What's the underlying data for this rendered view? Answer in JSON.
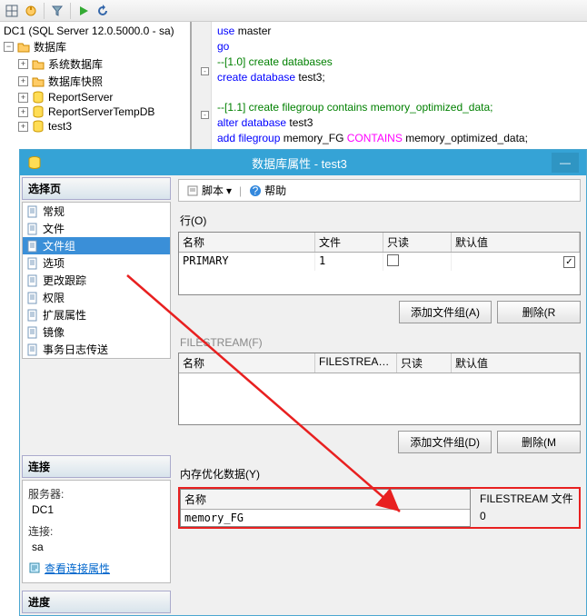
{
  "toolbar": {
    "icons": [
      "grid",
      "conn",
      "sep",
      "filter",
      "sep",
      "play",
      "refresh"
    ]
  },
  "server": {
    "name": "DC1 (SQL Server 12.0.5000.0 - sa)"
  },
  "tree": {
    "root": "数据库",
    "items": [
      "系统数据库",
      "数据库快照",
      "ReportServer",
      "ReportServerTempDB",
      "test3"
    ]
  },
  "editor": {
    "lines": [
      {
        "t": "use",
        "k": "kw",
        "r": " master"
      },
      {
        "t": "go",
        "k": "kw"
      },
      {
        "t": "--[1.0] create databases",
        "k": "comment"
      },
      {
        "pre": "create database",
        "post": " test3;",
        "collapse": true
      },
      {
        "t": "",
        "k": "ident"
      },
      {
        "t": "--[1.1] create filegroup contains memory_optimized_data;",
        "k": "comment"
      },
      {
        "pre": "alter database",
        "post": " test3",
        "collapse": true
      },
      {
        "add": "add filegroup",
        "name": " memory_FG ",
        "kw2": "CONTAINS",
        "end": " memory_optimized_data;"
      }
    ]
  },
  "dialog": {
    "title": "数据库属性 - test3",
    "left": {
      "sel_header": "选择页",
      "pages": [
        "常规",
        "文件",
        "文件组",
        "选项",
        "更改跟踪",
        "权限",
        "扩展属性",
        "镜像",
        "事务日志传送"
      ],
      "selected": "文件组",
      "conn_header": "连接",
      "server_lbl": "服务器:",
      "server_val": "DC1",
      "conn_lbl": "连接:",
      "conn_val": "sa",
      "view_link": "查看连接属性",
      "progress_header": "进度"
    },
    "right": {
      "script_btn": "脚本",
      "help_btn": "帮助",
      "rows_label": "行(O)",
      "grid1": {
        "cols": [
          "名称",
          "文件",
          "只读",
          "默认值"
        ],
        "row": {
          "name": "PRIMARY",
          "files": "1",
          "readonly": "",
          "default": "✓"
        }
      },
      "add_btn": "添加文件组(A)",
      "del_btn": "删除(R",
      "fs_label": "FILESTREAM(F)",
      "grid2": {
        "cols": [
          "名称",
          "FILESTREA…",
          "只读",
          "默认值"
        ]
      },
      "add_btn2": "添加文件组(D)",
      "del_btn2": "删除(M",
      "mem_label": "内存优化数据(Y)",
      "mem": {
        "name_col": "名称",
        "name_val": "memory_FG",
        "fs_col": "FILESTREAM 文件",
        "fs_val": "0"
      }
    }
  }
}
